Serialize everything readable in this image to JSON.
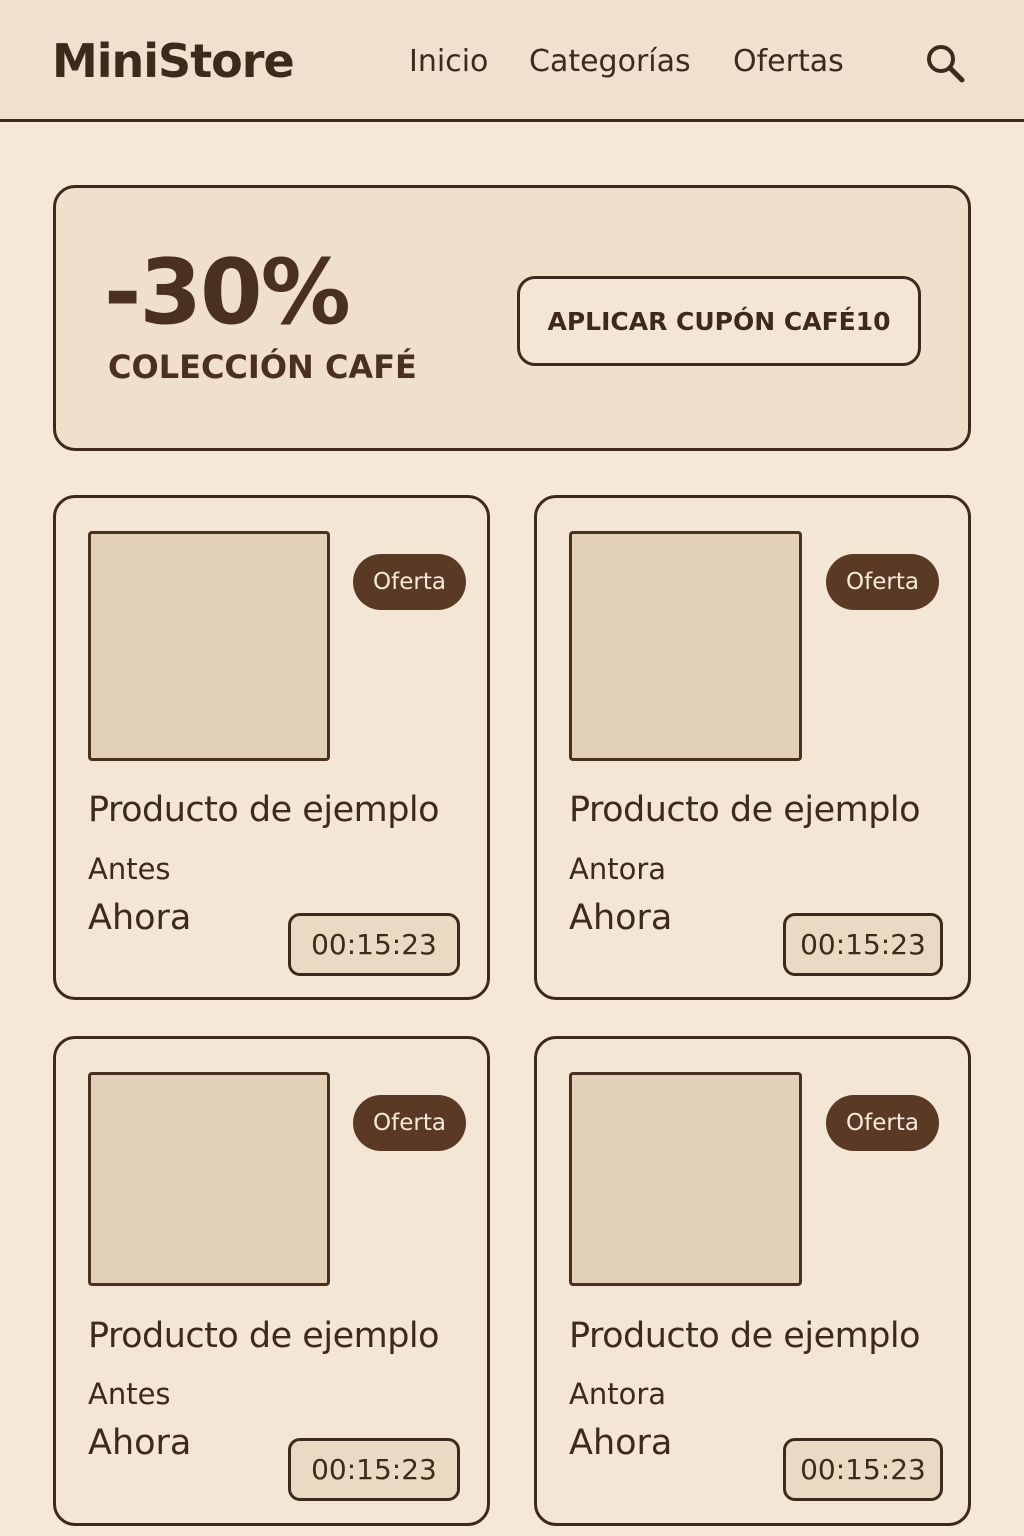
{
  "header": {
    "logo": "MiniStore",
    "nav": [
      "Inicio",
      "Categorías",
      "Ofertas"
    ],
    "search_icon": "search-icon"
  },
  "banner": {
    "discount": "-30%",
    "collection": "COLECCIÓN CAFÉ",
    "coupon_button": "APLICAR CUPÓN CAFÉ10"
  },
  "products": [
    {
      "badge": "Oferta",
      "title": "Producto de ejemplo",
      "before": "Antes",
      "now": "Ahora",
      "timer": "00:15:23"
    },
    {
      "badge": "Oferta",
      "title": "Producto de ejemplo",
      "before": "Antora",
      "now": "Ahora",
      "timer": "00:15:23"
    },
    {
      "badge": "Oferta",
      "title": "Producto de ejemplo",
      "before": "Antes",
      "now": "Ahora",
      "timer": "00:15:23"
    },
    {
      "badge": "Oferta",
      "title": "Producto de ejemplo",
      "before": "Antora",
      "now": "Ahora",
      "timer": "00:15:23"
    }
  ],
  "colors": {
    "background": "#f5e8d8",
    "accent_dark": "#3d2a1c",
    "badge": "#5a3a24"
  }
}
